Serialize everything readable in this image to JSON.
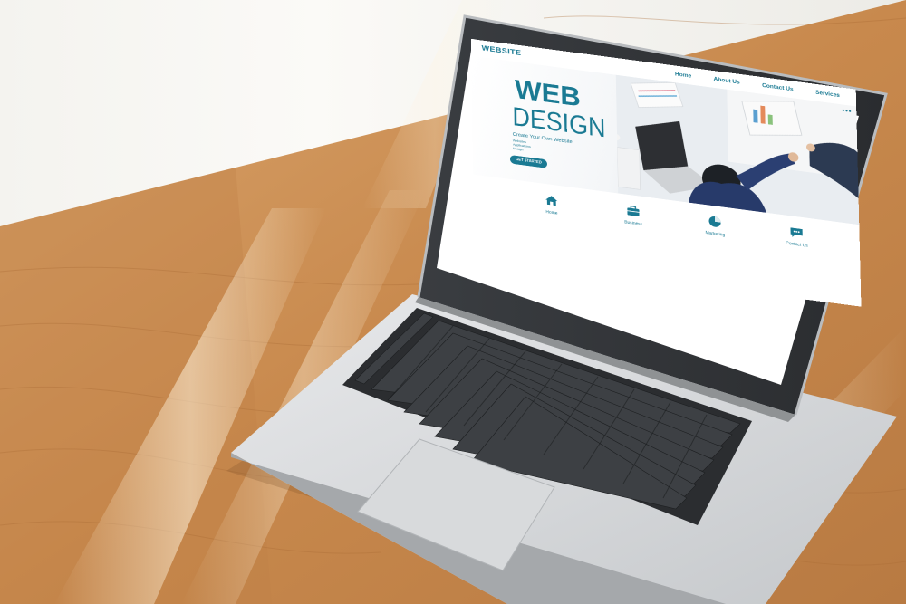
{
  "site": {
    "logo": "WEBSITE",
    "nav": [
      "Home",
      "About Us",
      "Contact Us",
      "Services"
    ],
    "menu_dots": "•••"
  },
  "hero": {
    "title_line1": "WEB",
    "title_line2": "DESIGN",
    "subtitle": "Create Your Own Website",
    "list": [
      "Websites",
      "Applications",
      "Design"
    ],
    "cta_label": "GET STARTED"
  },
  "features": [
    {
      "label": "Home",
      "icon": "home-icon"
    },
    {
      "label": "Business",
      "icon": "briefcase-icon"
    },
    {
      "label": "Marketing",
      "icon": "pie-chart-icon"
    },
    {
      "label": "Contact Us",
      "icon": "chat-icon"
    }
  ],
  "colors": {
    "accent": "#1a7a93",
    "table_wood": "#c98f55",
    "laptop_silver": "#d7d9db"
  }
}
